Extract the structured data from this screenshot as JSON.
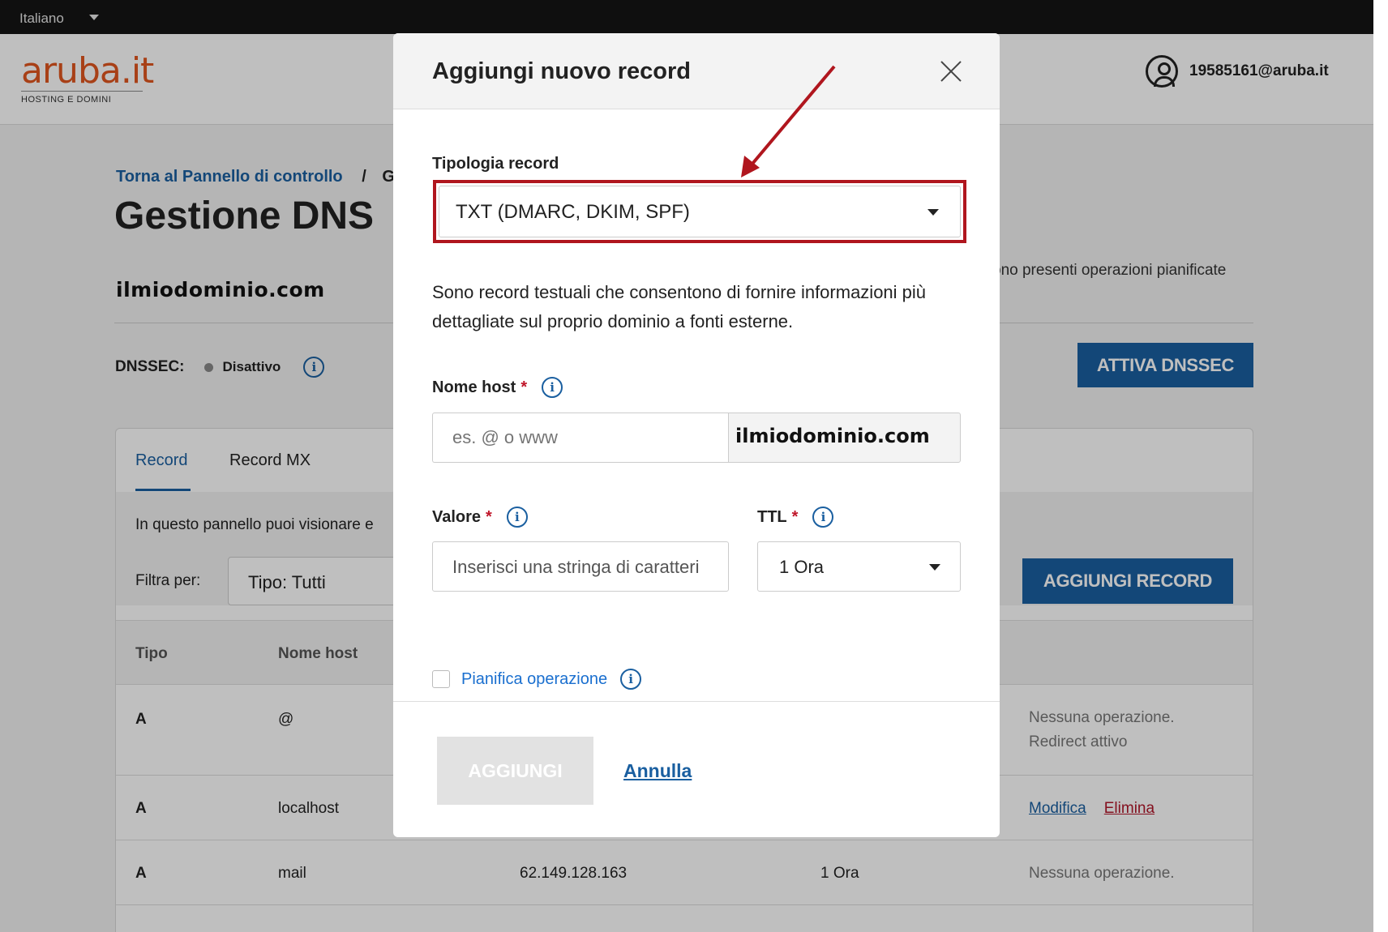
{
  "langbar": {
    "language": "Italiano"
  },
  "header": {
    "logo_text": "aruba.it",
    "logo_sub": "HOSTING E DOMINI",
    "user_email": "19585161@aruba.it"
  },
  "page": {
    "breadcrumb_link": "Torna al Pannello di controllo",
    "breadcrumb_sep": "/",
    "breadcrumb_next": "G",
    "title": "Gestione DNS",
    "domain": "ilmiodominio.com",
    "planned_text": "ono presenti operazioni pianificate",
    "dnssec_label": "DNSSEC:",
    "dnssec_status": "Disattivo",
    "dnssec_button": "ATTIVA DNSSEC",
    "tabs": [
      {
        "label": "Record"
      },
      {
        "label": "Record MX"
      }
    ],
    "panel_desc": "In questo pannello puoi visionare e",
    "filter_label": "Filtra per:",
    "filter_value": "Tipo: Tutti",
    "add_record_button": "AGGIUNGI RECORD",
    "table_headers": {
      "tipo": "Tipo",
      "nome_host": "Nome host"
    },
    "rows": [
      {
        "type": "A",
        "host": "@",
        "value": "",
        "ttl": "",
        "ops_line1": "Nessuna operazione.",
        "ops_line2": "Redirect attivo"
      },
      {
        "type": "A",
        "host": "localhost",
        "value": "",
        "ttl": "",
        "edit": "Modifica",
        "delete": "Elimina"
      },
      {
        "type": "A",
        "host": "mail",
        "value": "62.149.128.163",
        "ttl": "1 Ora",
        "ops_line1": "Nessuna operazione."
      }
    ]
  },
  "modal": {
    "title": "Aggiungi nuovo record",
    "type_label": "Tipologia record",
    "type_value": "TXT (DMARC, DKIM, SPF)",
    "description": "Sono record testuali che consentono di fornire informazioni più dettagliate sul proprio dominio a fonti esterne.",
    "host_label": "Nome host",
    "required_mark": "*",
    "host_placeholder": "es. @ o www",
    "host_suffix": "ilmiodominio.com",
    "value_label": "Valore",
    "value_placeholder": "Inserisci una stringa di caratteri",
    "ttl_label": "TTL",
    "ttl_value": "1 Ora",
    "schedule_label": "Pianifica operazione",
    "submit_button": "AGGIUNGI",
    "cancel_link": "Annulla"
  },
  "colors": {
    "brand_orange": "#e0561f",
    "primary_blue": "#1a5fa0",
    "highlight_red": "#b0161e",
    "required_red": "#c0162a"
  }
}
